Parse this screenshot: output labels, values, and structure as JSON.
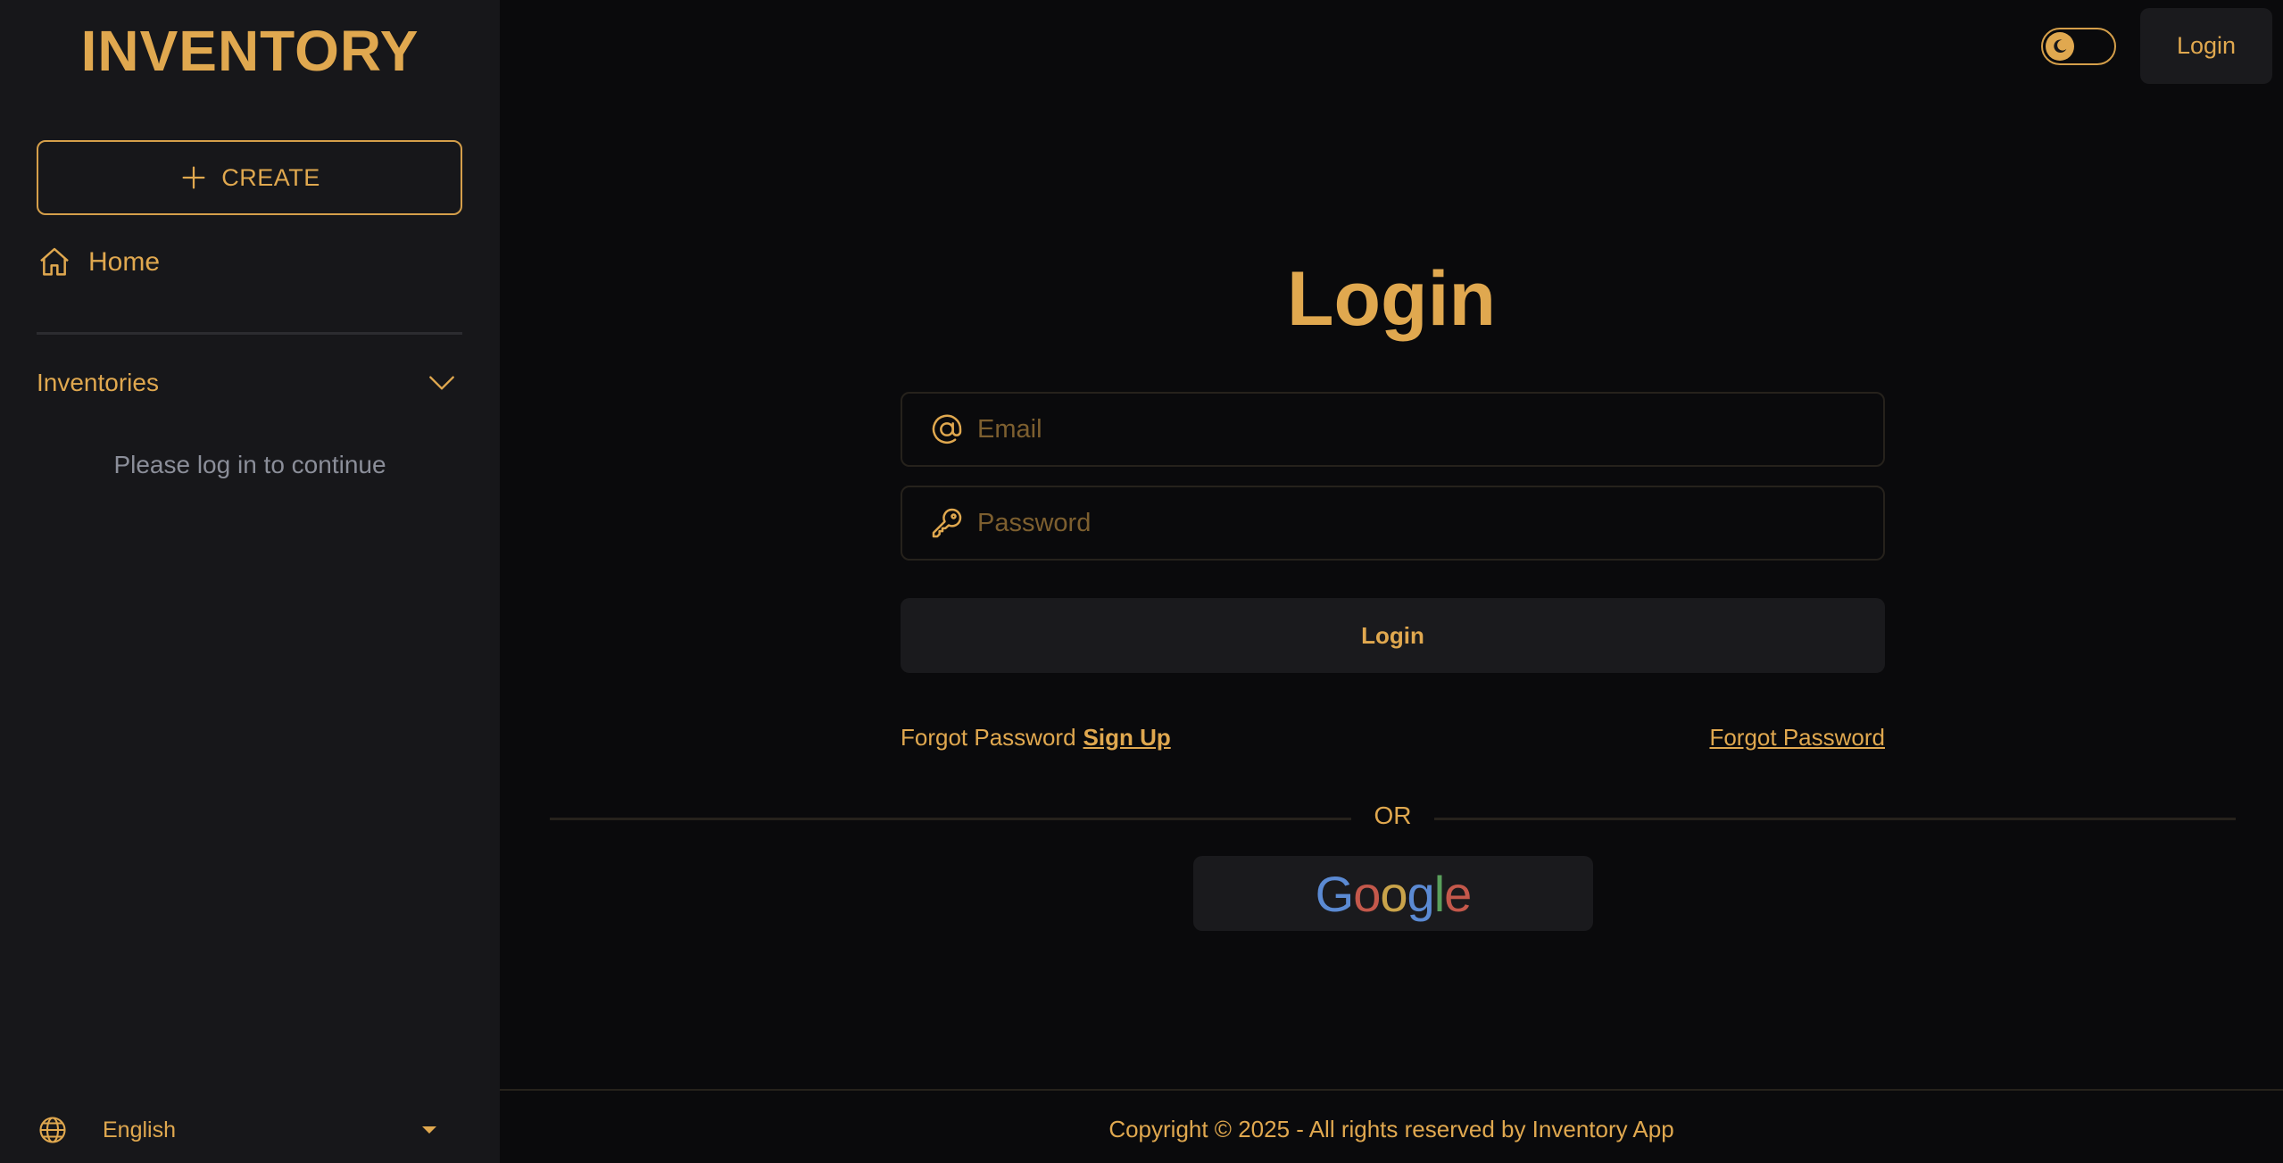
{
  "sidebar": {
    "brand": "INVENTORY",
    "create_label": "CREATE",
    "home_label": "Home",
    "inventories_label": "Inventories",
    "login_hint": "Please log in to continue",
    "language": "English"
  },
  "topbar": {
    "login_label": "Login"
  },
  "login": {
    "title": "Login",
    "email_placeholder": "Email",
    "password_placeholder": "Password",
    "submit_label": "Login",
    "forgot_left": "Forgot Password",
    "signup_label": "Sign Up",
    "forgot_right": "Forgot Password",
    "or_label": "OR",
    "google_letters": [
      "G",
      "o",
      "o",
      "g",
      "l",
      "e"
    ]
  },
  "footer": {
    "copyright": "Copyright © 2025 - All rights reserved by Inventory App"
  },
  "colors": {
    "accent": "#e0a84f",
    "sidebar_bg": "#17171a",
    "main_bg": "#0a0a0c",
    "muted_text": "#8b8e99"
  },
  "icons": [
    "plus-icon",
    "home-icon",
    "chevron-down-icon",
    "globe-icon",
    "caret-down-icon",
    "moon-icon",
    "at-icon",
    "key-icon"
  ]
}
